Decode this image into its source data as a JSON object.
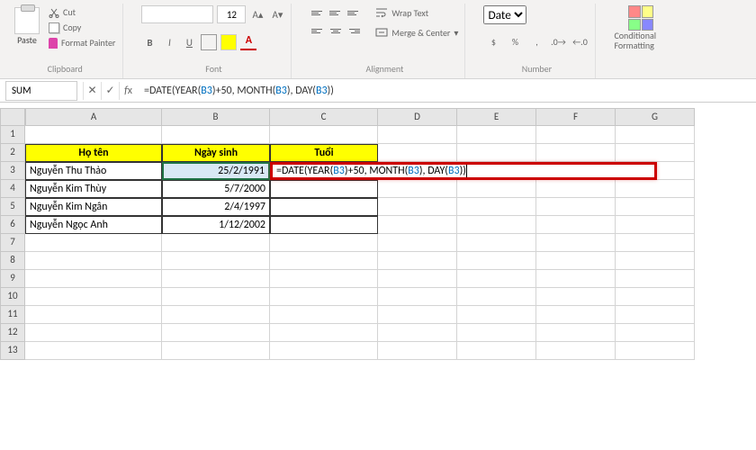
{
  "ribbon": {
    "clipboard": {
      "paste": "Paste",
      "cut": "Cut",
      "copy": "Copy",
      "painter": "Format Painter",
      "label": "Clipboard"
    },
    "font": {
      "name": "",
      "size": "12",
      "label": "Font"
    },
    "alignment": {
      "wrap": "Wrap Text",
      "merge": "Merge & Center",
      "label": "Alignment"
    },
    "number": {
      "format": "Date",
      "label": "Number"
    },
    "styles": {
      "conditional": "Conditional Formatting"
    }
  },
  "formula_bar": {
    "name_box": "SUM",
    "formula_text": "=DATE(YEAR(B3)+50, MONTH(B3), DAY(B3))"
  },
  "columns": [
    "A",
    "B",
    "C",
    "D",
    "E",
    "F",
    "G"
  ],
  "rows": [
    "1",
    "2",
    "3",
    "4",
    "5",
    "6",
    "7",
    "8",
    "9",
    "10",
    "11",
    "12",
    "13"
  ],
  "headers": {
    "a": "Họ tên",
    "b": "Ngày sinh",
    "c": "Tuổi"
  },
  "data_rows": [
    {
      "name": "Nguyễn Thu Thảo",
      "dob": "25/2/1991"
    },
    {
      "name": "Nguyễn Kim Thùy",
      "dob": "5/7/2000"
    },
    {
      "name": "Nguyễn Kim Ngân",
      "dob": "2/4/1997"
    },
    {
      "name": "Nguyễn Ngọc Anh",
      "dob": "1/12/2002"
    }
  ],
  "editing_formula": "=DATE(YEAR(B3)+50, MONTH(B3), DAY(B3))"
}
